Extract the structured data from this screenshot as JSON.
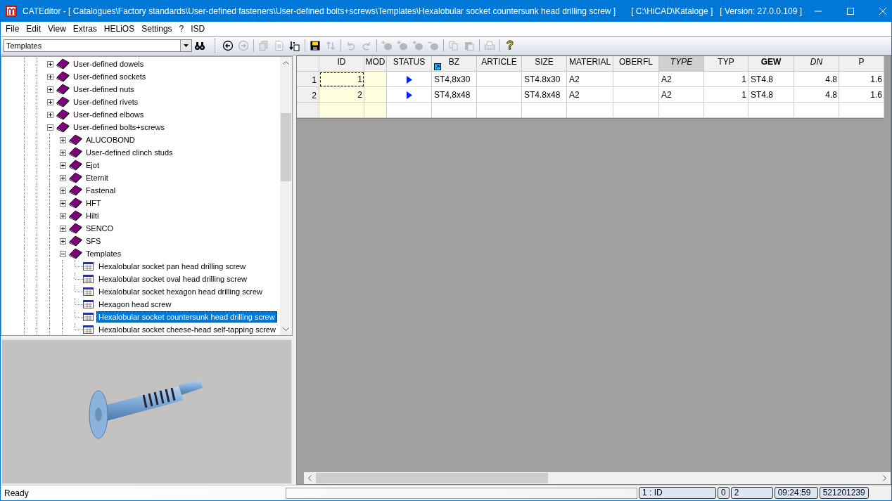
{
  "window": {
    "title": "CATEditor - [ Catalogues\\Factory standards\\User-defined fasteners\\User-defined bolts+screws\\Templates\\Hexalobular socket countersunk head drilling screw ]",
    "path": "[ C:\\HiCAD\\Kataloge ]",
    "version": "[ Version: 27.0.0.109 ]"
  },
  "menu": [
    "File",
    "Edit",
    "View",
    "Extras",
    "HELiOS",
    "Settings",
    "?",
    "ISD"
  ],
  "toolbar": {
    "combo": {
      "value": "Templates"
    },
    "tool_groups": [
      [
        {
          "kind": "back",
          "disabled": false
        },
        {
          "kind": "forward",
          "disabled": true
        }
      ],
      [
        {
          "kind": "copy-doc",
          "disabled": true
        },
        {
          "kind": "doc",
          "disabled": true
        },
        {
          "kind": "sort-doc",
          "disabled": false
        }
      ],
      [
        {
          "kind": "save",
          "disabled": false
        },
        {
          "kind": "sort",
          "disabled": true
        }
      ],
      [
        {
          "kind": "undo",
          "disabled": true
        },
        {
          "kind": "redo",
          "disabled": true
        }
      ],
      [
        {
          "kind": "add-row",
          "disabled": true
        },
        {
          "kind": "add-row",
          "disabled": true
        },
        {
          "kind": "add-row",
          "disabled": true
        },
        {
          "kind": "remove-row",
          "disabled": true
        }
      ],
      [
        {
          "kind": "copy",
          "disabled": true
        },
        {
          "kind": "paste",
          "disabled": true
        }
      ],
      [
        {
          "kind": "print",
          "disabled": true
        }
      ],
      [
        {
          "kind": "help",
          "disabled": false,
          "glyph": "?"
        }
      ]
    ]
  },
  "tree": [
    {
      "label": "User-defined dowels",
      "kind": "folder",
      "expanded": false,
      "selected": false
    },
    {
      "label": "User-defined sockets",
      "kind": "folder",
      "expanded": false,
      "selected": false
    },
    {
      "label": "User-defined nuts",
      "kind": "folder",
      "expanded": false,
      "selected": false
    },
    {
      "label": "User-defined rivets",
      "kind": "folder",
      "expanded": false,
      "selected": false
    },
    {
      "label": "User-defined elbows",
      "kind": "folder",
      "expanded": false,
      "selected": false
    },
    {
      "label": "User-defined bolts+screws",
      "kind": "folder",
      "expanded": true,
      "selected": false,
      "children": [
        {
          "label": "ALUCOBOND",
          "kind": "folder",
          "expanded": false,
          "selected": false
        },
        {
          "label": "User-defined clinch studs",
          "kind": "folder",
          "expanded": false,
          "selected": false
        },
        {
          "label": "Ejot",
          "kind": "folder",
          "expanded": false,
          "selected": false
        },
        {
          "label": "Eternit",
          "kind": "folder",
          "expanded": false,
          "selected": false
        },
        {
          "label": "Fastenal",
          "kind": "folder",
          "expanded": false,
          "selected": false
        },
        {
          "label": "HFT",
          "kind": "folder",
          "expanded": false,
          "selected": false
        },
        {
          "label": "Hilti",
          "kind": "folder",
          "expanded": false,
          "selected": false
        },
        {
          "label": "SENCO",
          "kind": "folder",
          "expanded": false,
          "selected": false
        },
        {
          "label": "SFS",
          "kind": "folder",
          "expanded": false,
          "selected": false
        },
        {
          "label": "Templates",
          "kind": "folder",
          "expanded": true,
          "selected": false,
          "children": [
            {
              "label": "Hexalobular socket pan head drilling screw",
              "kind": "table",
              "selected": false
            },
            {
              "label": "Hexalobular socket oval head drilling screw",
              "kind": "table",
              "selected": false
            },
            {
              "label": "Hexalobular socket hexagon head drilling screw",
              "kind": "table",
              "selected": false
            },
            {
              "label": "Hexagon head screw",
              "kind": "table",
              "selected": false
            },
            {
              "label": "Hexalobular socket countersunk head drilling screw",
              "kind": "table",
              "selected": true
            },
            {
              "label": "Hexalobular socket cheese-head self-tapping screw",
              "kind": "table",
              "selected": false
            }
          ]
        }
      ]
    }
  ],
  "grid": {
    "columns": [
      {
        "label": "ID",
        "kind": "number",
        "key": true,
        "highlighted": false,
        "link_icon": false
      },
      {
        "label": "MOD",
        "kind": "text",
        "key": true,
        "highlighted": false,
        "link_icon": false
      },
      {
        "label": "STATUS",
        "kind": "status",
        "key": false,
        "highlighted": false,
        "link_icon": false
      },
      {
        "label": "BZ",
        "kind": "text",
        "key": false,
        "highlighted": false,
        "link_icon": true
      },
      {
        "label": "ARTICLE",
        "kind": "text",
        "key": false,
        "highlighted": false,
        "link_icon": false
      },
      {
        "label": "SIZE",
        "kind": "text",
        "key": false,
        "highlighted": false,
        "link_icon": false
      },
      {
        "label": "MATERIAL",
        "kind": "text",
        "key": false,
        "highlighted": false,
        "link_icon": false
      },
      {
        "label": "OBERFL",
        "kind": "text",
        "key": false,
        "highlighted": false,
        "link_icon": false
      },
      {
        "label": "TYPE",
        "kind": "text",
        "key": false,
        "highlighted": true,
        "link_icon": false
      },
      {
        "label": "TYP",
        "kind": "number",
        "key": false,
        "highlighted": false,
        "link_icon": false
      },
      {
        "label": "GEW",
        "kind": "text",
        "key": false,
        "highlighted": false,
        "link_icon": false
      },
      {
        "label": "DN",
        "kind": "number",
        "key": false,
        "highlighted": false,
        "link_icon": false
      },
      {
        "label": "P",
        "kind": "number",
        "key": false,
        "highlighted": false,
        "link_icon": false
      }
    ],
    "rows": [
      {
        "number": "1",
        "focused": true,
        "status_marker": true,
        "cells": [
          "1",
          null,
          null,
          "ST4,8x30",
          null,
          "ST4.8x30",
          "A2",
          null,
          "A2",
          "1",
          "ST4.8",
          "4.8",
          "1.6"
        ]
      },
      {
        "number": "2",
        "focused": false,
        "status_marker": true,
        "cells": [
          "2",
          null,
          null,
          "ST4,8x48",
          null,
          "ST4.8x48",
          "A2",
          null,
          "A2",
          "1",
          "ST4.8",
          "4.8",
          "1.6"
        ]
      }
    ]
  },
  "status_bar": {
    "message": "Ready",
    "panels": [
      "1 : ID",
      "0",
      "2",
      "09:24:59",
      "521201239"
    ]
  }
}
